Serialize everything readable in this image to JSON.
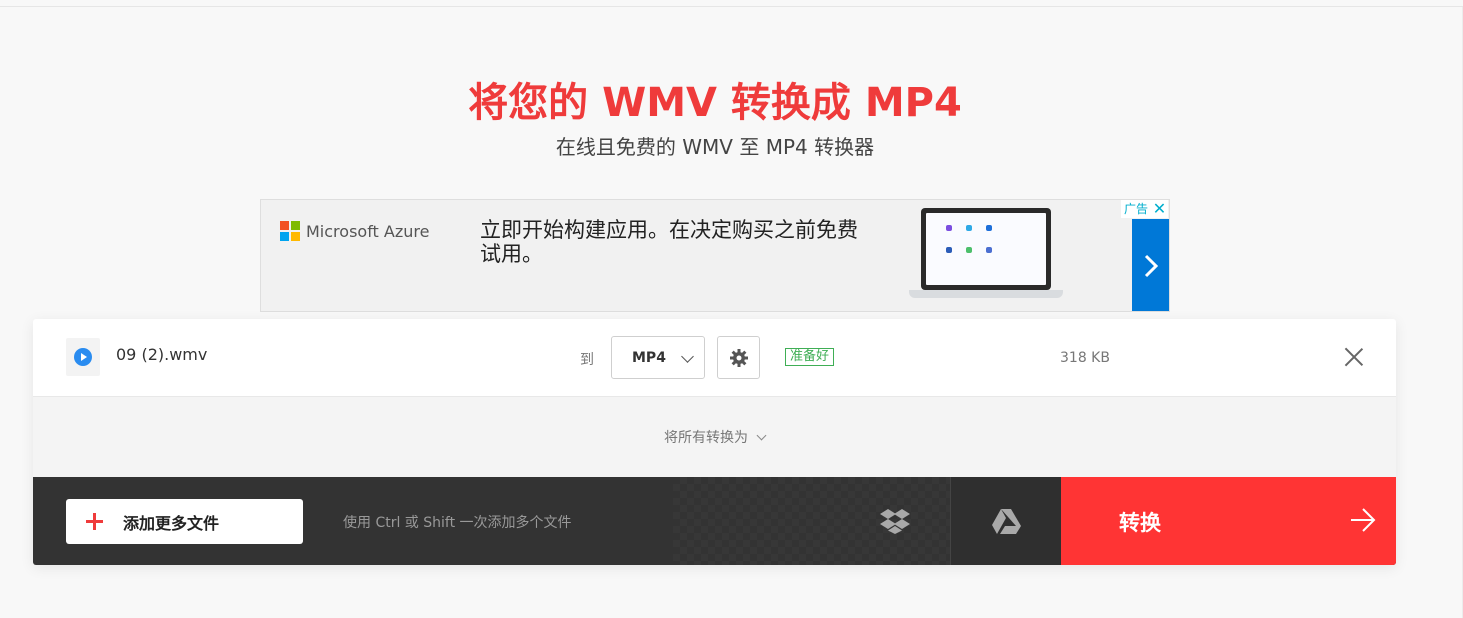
{
  "header": {
    "title": "将您的 WMV 转换成 MP4",
    "subtitle": "在线且免费的 WMV 至 MP4 转换器"
  },
  "ad": {
    "brand": "Microsoft Azure",
    "text": "立即开始构建应用。在决定购买之前免费试用。",
    "badge": "广告",
    "close_symbol": "✕",
    "next_icon": "chevron-right-icon"
  },
  "file": {
    "name": "09 (2).wmv",
    "to_label": "到",
    "format": "MP4",
    "status": "准备好",
    "size": "318 KB"
  },
  "convert_all": {
    "label": "将所有转换为"
  },
  "bottom_bar": {
    "add_label": "添加更多文件",
    "hint": "使用 Ctrl 或 Shift 一次添加多个文件",
    "convert_label": "转换"
  },
  "colors": {
    "accent": "#ef3b3b",
    "convert_bg": "#ff3434",
    "ad_blue": "#0078d7",
    "status_green": "#3fae55",
    "bar_bg": "#333333"
  },
  "icons": [
    "play-icon",
    "chevron-down-icon",
    "gear-icon",
    "close-icon",
    "plus-icon",
    "dropbox-icon",
    "google-drive-icon",
    "arrow-right-icon"
  ]
}
